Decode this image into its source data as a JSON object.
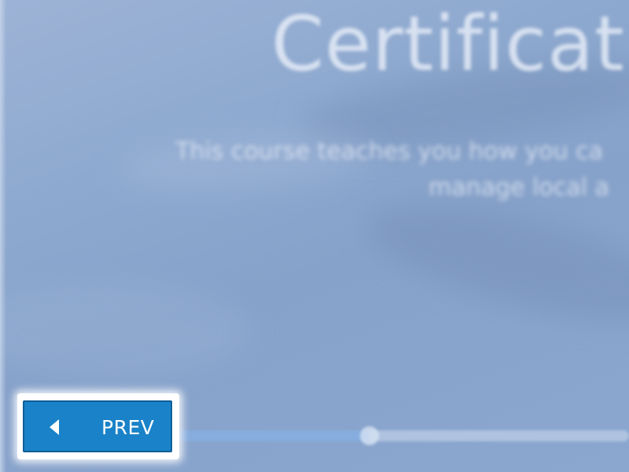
{
  "page": {
    "title": "Certificat",
    "subtitle_line1": "This course teaches you how you ca",
    "subtitle_line2": "manage local a"
  },
  "navigation": {
    "prev_label": "PREV",
    "prev_icon": "caret-left-icon"
  },
  "progress": {
    "fraction": 0.45
  },
  "colors": {
    "background": "#8ea9cf",
    "button": "#1a82c8",
    "button_border": "#0f5e97",
    "text": "#ffffff"
  }
}
